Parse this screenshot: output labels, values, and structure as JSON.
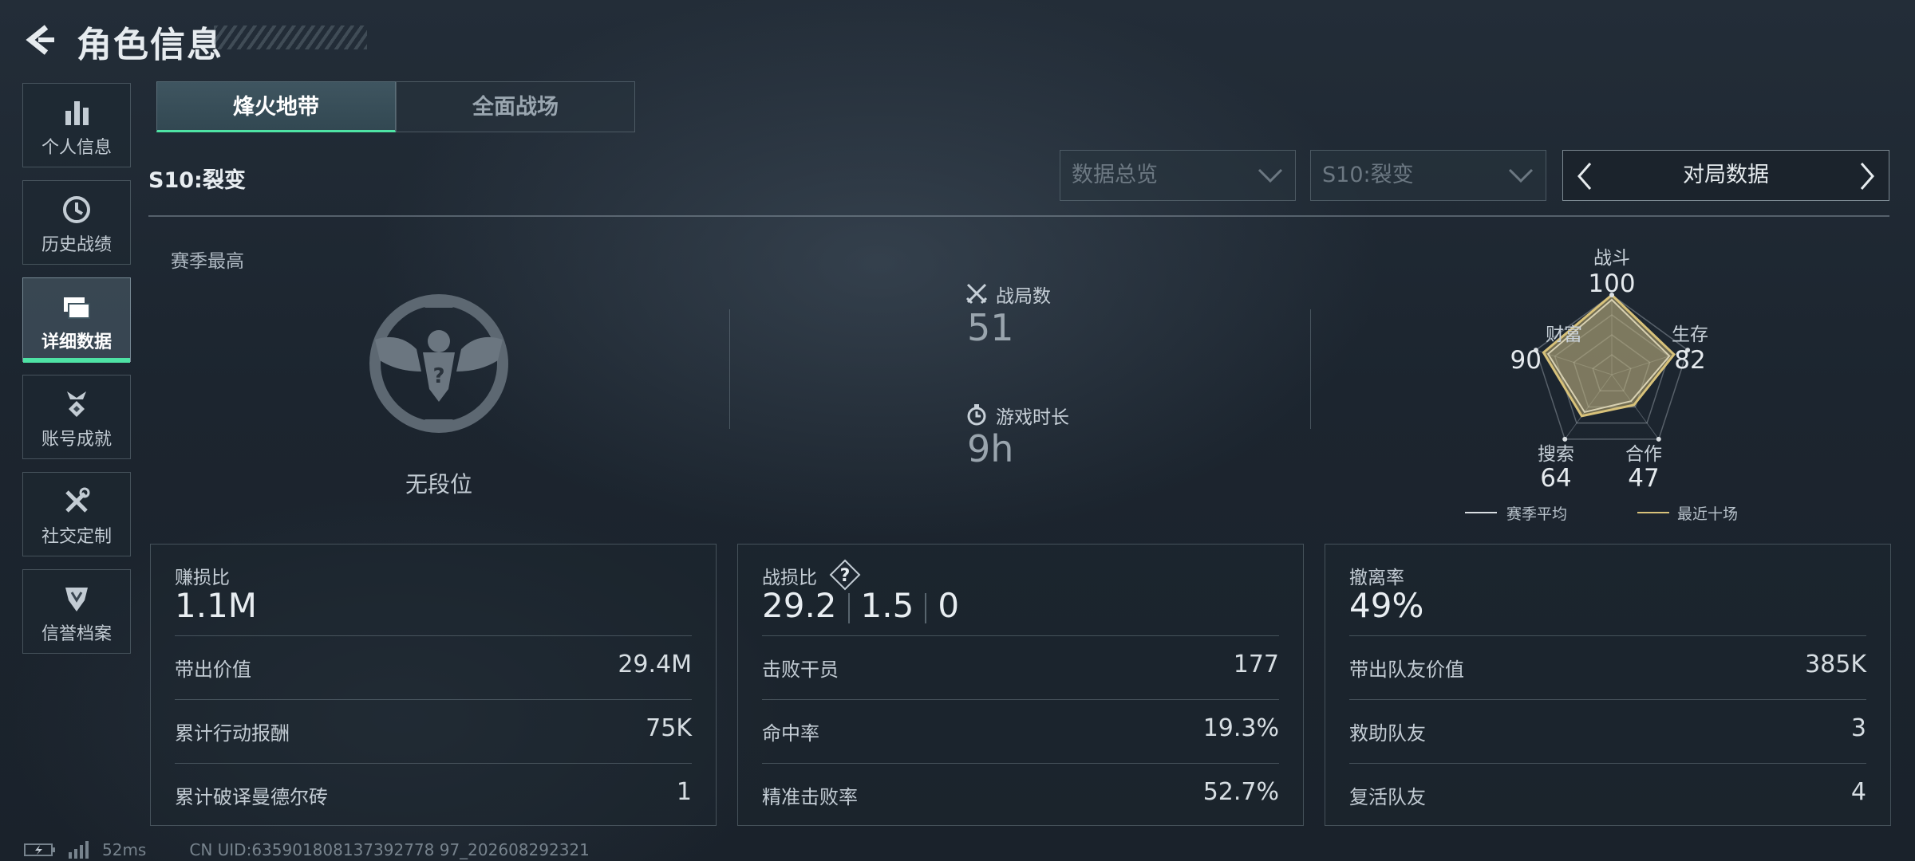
{
  "header": {
    "title": "角色信息"
  },
  "sidebar": {
    "items": [
      {
        "label": "个人信息",
        "icon": "bar-chart-icon"
      },
      {
        "label": "历史战绩",
        "icon": "history-icon"
      },
      {
        "label": "详细数据",
        "icon": "folder-icon",
        "active": true
      },
      {
        "label": "账号成就",
        "icon": "medal-icon"
      },
      {
        "label": "社交定制",
        "icon": "tools-icon"
      },
      {
        "label": "信誉档案",
        "icon": "shield-badge-icon"
      }
    ]
  },
  "tabs": [
    {
      "label": "烽火地带",
      "active": true
    },
    {
      "label": "全面战场",
      "active": false
    }
  ],
  "filters": {
    "season_title": "S10:裂变",
    "overview_dropdown": "数据总览",
    "season_dropdown": "S10:裂变",
    "pager_label": "对局数据"
  },
  "summary": {
    "season_best_label": "赛季最高",
    "rank": "无段位",
    "matches_label": "战局数",
    "matches_value": "51",
    "playtime_label": "游戏时长",
    "playtime_value": "9h"
  },
  "radar": {
    "axes": [
      {
        "label": "战斗",
        "value": "100",
        "num": 100
      },
      {
        "label": "生存",
        "value": "82",
        "num": 82
      },
      {
        "label": "合作",
        "value": "47",
        "num": 47
      },
      {
        "label": "搜索",
        "value": "64",
        "num": 64
      },
      {
        "label": "财富",
        "value": "90",
        "num": 90
      }
    ],
    "legend": {
      "season_avg": "赛季平均",
      "recent_ten": "最近十场"
    },
    "colors": {
      "recent": "#d8c27a",
      "season": "#d9dee2"
    }
  },
  "cards": {
    "profit": {
      "title": "赚损比",
      "big": "1.1M",
      "rows": [
        {
          "label": "带出价值",
          "value": "29.4M"
        },
        {
          "label": "累计行动报酬",
          "value": "75K"
        },
        {
          "label": "累计破译曼德尔砖",
          "value": "1"
        }
      ]
    },
    "kd": {
      "title": "战损比",
      "v1": "29.2",
      "v2": "1.5",
      "v3": "0",
      "rows": [
        {
          "label": "击败干员",
          "value": "177"
        },
        {
          "label": "命中率",
          "value": "19.3%"
        },
        {
          "label": "精准击败率",
          "value": "52.7%"
        }
      ]
    },
    "extract": {
      "title": "撤离率",
      "big": "49%",
      "rows": [
        {
          "label": "带出队友价值",
          "value": "385K"
        },
        {
          "label": "救助队友",
          "value": "3"
        },
        {
          "label": "复活队友",
          "value": "4"
        }
      ]
    }
  },
  "footer": {
    "ping": "52ms",
    "uid": "CN UID:635901808137392778 97_202608292321"
  },
  "colors": {
    "accent": "#4ee3a5"
  }
}
